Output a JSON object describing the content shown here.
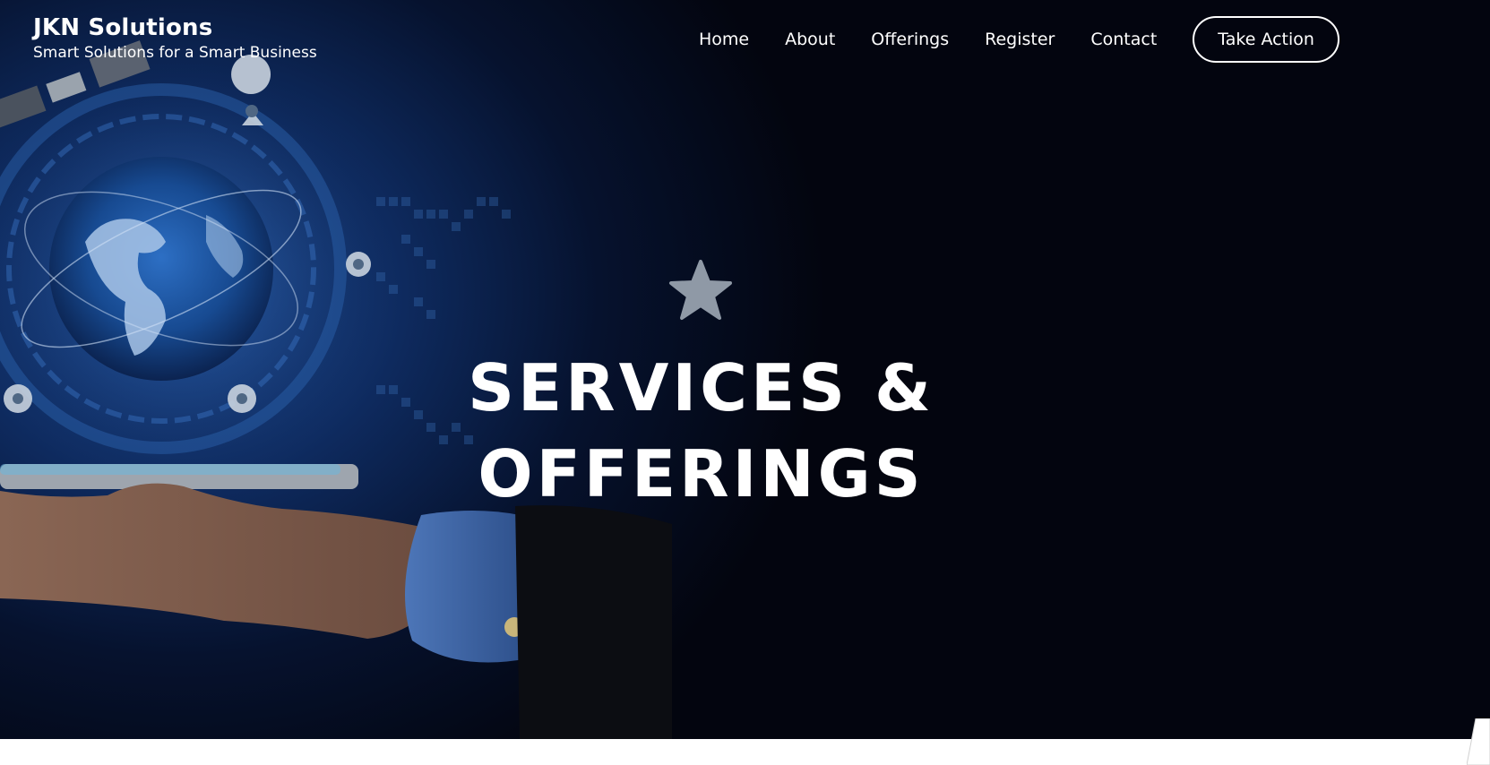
{
  "brand": {
    "title": "JKN Solutions",
    "tagline": "Smart Solutions for a Smart Business"
  },
  "nav": {
    "items": [
      "Home",
      "About",
      "Offerings",
      "Register",
      "Contact"
    ],
    "cta_label": "Take Action"
  },
  "hero": {
    "icon": "star-icon",
    "title_line1": "SERVICES &",
    "title_line2": "OFFERINGS"
  },
  "colors": {
    "hero_dark": "#03050f",
    "hero_blue": "#1f4f9a",
    "star": "#8f99a6",
    "text": "#ffffff"
  }
}
